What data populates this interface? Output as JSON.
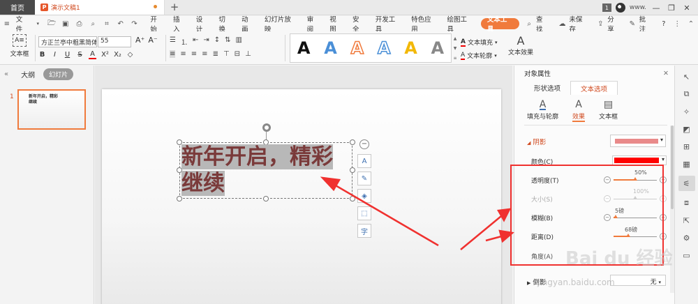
{
  "titlebar": {
    "home_tab": "首页",
    "doc_icon": "P",
    "doc_title": "演示文稿1",
    "add_tab": "+",
    "window_count": "1",
    "user": "www.",
    "min": "—",
    "restore": "❐",
    "close": "✕"
  },
  "menubar": {
    "file": "文件",
    "items": [
      "开始",
      "插入",
      "设计",
      "切换",
      "动画",
      "幻灯片放映",
      "审阅",
      "视图",
      "安全",
      "开发工具",
      "特色应用",
      "绘图工具",
      "文本工具"
    ],
    "active_item": "文本工具",
    "search": "查找",
    "unsaved": "未保存",
    "share": "分享",
    "comment": "批注",
    "help": "?"
  },
  "ribbon": {
    "textbox_label": "文本框",
    "font_name": "方正兰亭中粗黑简体",
    "font_size": "55",
    "grow": "A⁺",
    "shrink": "A⁻",
    "bold": "B",
    "italic": "I",
    "underline": "U",
    "strike": "S",
    "font_color": "A",
    "superscript": "X²",
    "subscript": "X₂",
    "clear": "◇",
    "text_fill": "文本填充",
    "text_outline": "文本轮廓",
    "text_effect": "文本效果",
    "wordart_glyph": "A"
  },
  "left_panel": {
    "outline_tab": "大纲",
    "slides_tab": "幻灯片",
    "slide_number": "1",
    "thumb_text": "新年开启，精彩继续"
  },
  "slide": {
    "line1": "新年开启，精彩",
    "line2": "继续",
    "tool_minus": "−",
    "tool_layout": "A",
    "tool_pen": "✎",
    "tool_fill": "◈",
    "tool_crop": "⬚",
    "tool_char": "字"
  },
  "property_panel": {
    "title": "对象属性",
    "close": "✕",
    "tab_shape": "形状选项",
    "tab_text": "文本选项",
    "sub_fill": "填充与轮廓",
    "sub_effect": "效果",
    "sub_textbox": "文本框",
    "section_shadow": "阴影",
    "color_label": "颜色(C)",
    "transparency_label": "透明度(T)",
    "transparency_value": "50%",
    "size_label": "大小(S)",
    "size_value": "100%",
    "blur_label": "模糊(B)",
    "blur_value": "5磅",
    "distance_label": "距离(D)",
    "distance_value": "68磅",
    "angle_label": "角度(A)",
    "reflection_label": "倒影",
    "reflection_value": "无",
    "shadow_color": "#ff0000",
    "transparency_pct": 50,
    "size_pct": 100,
    "blur_pct": 5,
    "distance_pct": 34
  },
  "watermark": {
    "main": "Bai du 经验",
    "sub": "jingyan.baidu.com"
  }
}
